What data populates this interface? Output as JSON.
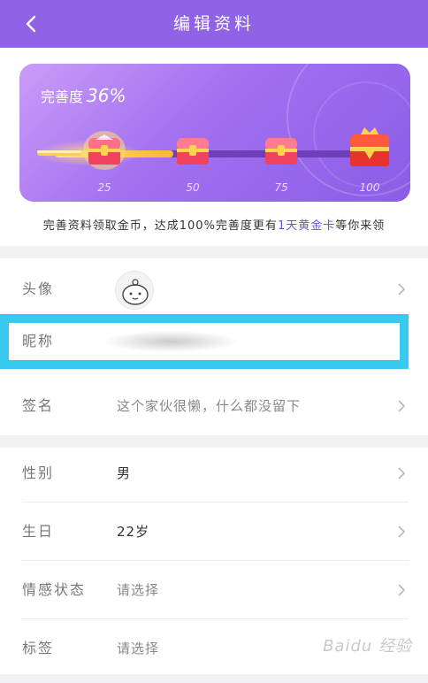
{
  "header": {
    "title": "编辑资料",
    "back_icon": "chevron-left-icon"
  },
  "colors": {
    "header_bg": "#8f62e6",
    "card_gradient_start": "#c99cf8",
    "card_gradient_end": "#8b5de6",
    "highlight_border": "#39c9ef",
    "link_purple": "#6f4fd8"
  },
  "progress": {
    "label": "完善度",
    "percent_text": "36%",
    "percent_value": 36,
    "milestones": [
      "25",
      "50",
      "75",
      "100"
    ],
    "chest_icon": "treasure-chest-icon",
    "key_icon": "golden-key-icon"
  },
  "promo": {
    "prefix": "完善资料领取金币，达成100%完善度更有",
    "highlight": "1天黄金卡",
    "suffix": "等你来领"
  },
  "profile": {
    "avatar_label": "头像",
    "nickname_label": "昵称",
    "signature_label": "签名",
    "signature_value": "这个家伙很懒，什么都没留下",
    "gender_label": "性别",
    "gender_value": "男",
    "birthday_label": "生日",
    "birthday_value": "22岁",
    "relationship_label": "情感状态",
    "relationship_value": "请选择",
    "tags_label": "标签",
    "tags_value": "请选择"
  },
  "watermark": "Baidu 经验"
}
